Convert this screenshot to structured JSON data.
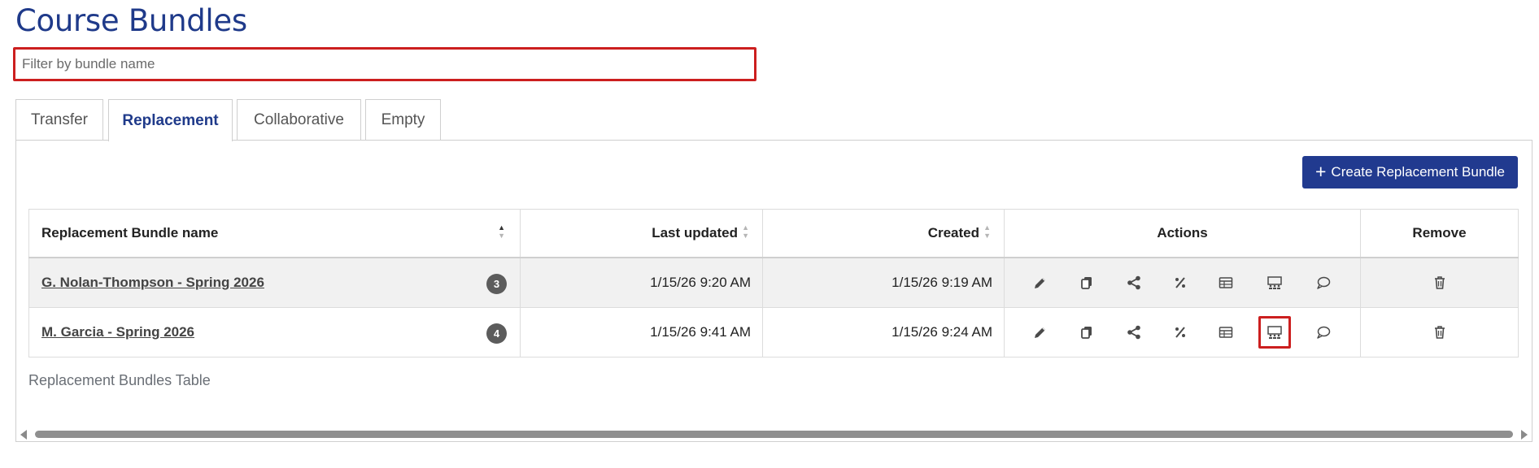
{
  "page": {
    "title": "Course Bundles"
  },
  "filter": {
    "placeholder": "Filter by bundle name",
    "value": ""
  },
  "tabs": [
    {
      "label": "Transfer",
      "active": false
    },
    {
      "label": "Replacement",
      "active": true
    },
    {
      "label": "Collaborative",
      "active": false
    },
    {
      "label": "Empty",
      "active": false
    }
  ],
  "create_button": {
    "label": "Create Replacement Bundle",
    "icon": "plus-icon"
  },
  "table": {
    "columns": [
      "Replacement Bundle name",
      "Last updated",
      "Created",
      "Actions",
      "Remove"
    ],
    "rows": [
      {
        "name": "G. Nolan-Thompson - Spring 2026",
        "count": "3",
        "last_updated": "1/15/26 9:20 AM",
        "created": "1/15/26 9:19 AM"
      },
      {
        "name": "M. Garcia - Spring 2026",
        "count": "4",
        "last_updated": "1/15/26 9:41 AM",
        "created": "1/15/26 9:24 AM"
      }
    ],
    "action_icons": [
      "pencil-icon",
      "copy-icon",
      "share-icon",
      "percent-icon",
      "table-icon",
      "classroom-icon",
      "comment-icon"
    ],
    "remove_icon": "trash-icon",
    "caption": "Replacement Bundles Table"
  },
  "colors": {
    "accent": "#213a8f",
    "title": "#1f3a8a",
    "highlight": "#cc1f1f",
    "badge": "#5c5c5c"
  }
}
